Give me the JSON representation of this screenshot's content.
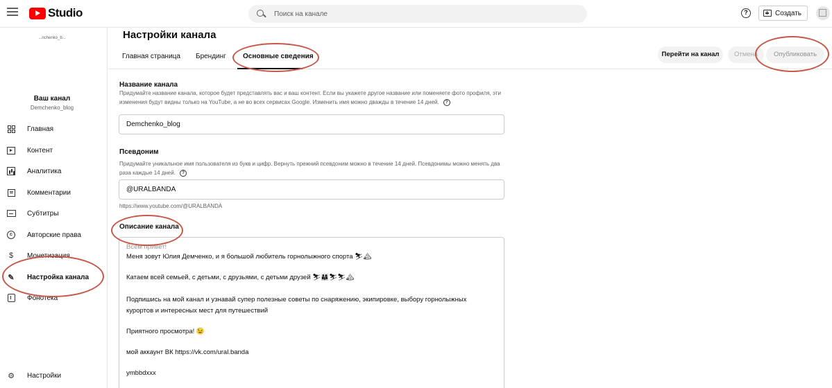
{
  "topbar": {
    "logo_text": "Studio",
    "search_placeholder": "Поиск на канале",
    "help": "?",
    "create_label": "Создать"
  },
  "sidebar": {
    "channel_image_text": "...nchenko_b...",
    "channel_title": "Ваш канал",
    "channel_handle": "Demchenko_blog",
    "items": [
      {
        "label": "Главная",
        "icon": "dashboard-icon"
      },
      {
        "label": "Контент",
        "icon": "content-icon"
      },
      {
        "label": "Аналитика",
        "icon": "analytics-icon"
      },
      {
        "label": "Комментарии",
        "icon": "comments-icon"
      },
      {
        "label": "Субтитры",
        "icon": "subtitles-icon"
      },
      {
        "label": "Авторские права",
        "icon": "copyright-icon"
      },
      {
        "label": "Монетизация",
        "icon": "monetization-icon"
      },
      {
        "label": "Настройка канала",
        "icon": "customization-icon"
      },
      {
        "label": "Фонотека",
        "icon": "audio-library-icon"
      }
    ],
    "settings_label": "Настройки"
  },
  "main": {
    "page_title": "Настройки канала",
    "tabs": [
      {
        "label": "Главная страница"
      },
      {
        "label": "Брендинг"
      },
      {
        "label": "Основные сведения"
      }
    ],
    "buttons": {
      "goto_channel": "Перейти на канал",
      "cancel": "Отмена",
      "publish": "Опубликовать"
    },
    "name_section": {
      "title": "Название канала",
      "desc": "Придумайте название канала, которое будет представлять вас и ваш контент. Если вы укажете другое название или поменяете фото профиля, эти изменения будут видны только на YouTube, а не во всех сервисах Google. Изменить имя можно дважды в течение 14 дней.",
      "value": "Demchenko_blog"
    },
    "handle_section": {
      "title": "Псевдоним",
      "desc": "Придумайте уникальное имя пользователя из букв и цифр. Вернуть прежний псевдоним можно в течение 14 дней. Псевдонимы можно менять два раза каждые 14 дней.",
      "value": "@URALBANDA",
      "url": "https://www.youtube.com/@URALBANDA"
    },
    "description_section": {
      "title": "Описание канала",
      "lines": [
        "Всем привет!",
        "Меня зовут Юлия Демченко, и я большой любитель горнолыжного спорта ⛷🏔",
        "Катаем всей семьей, с детьми, с друзьями, с детьми друзей ⛷👨‍👩‍👧⛷⛷🏔",
        "Подпишись на мой канал и узнавай супер полезные советы по снаряжению, экипировке, выбору горнолыжных",
        "курортов и интересных мест для путешествий",
        "Приятного просмотра! 😉",
        "мой аккаунт ВК https://vk.com/ural.banda",
        "ymbbdxxx"
      ]
    }
  },
  "colors": {
    "annotation": "#c75848",
    "brand_red": "#ff0000"
  }
}
